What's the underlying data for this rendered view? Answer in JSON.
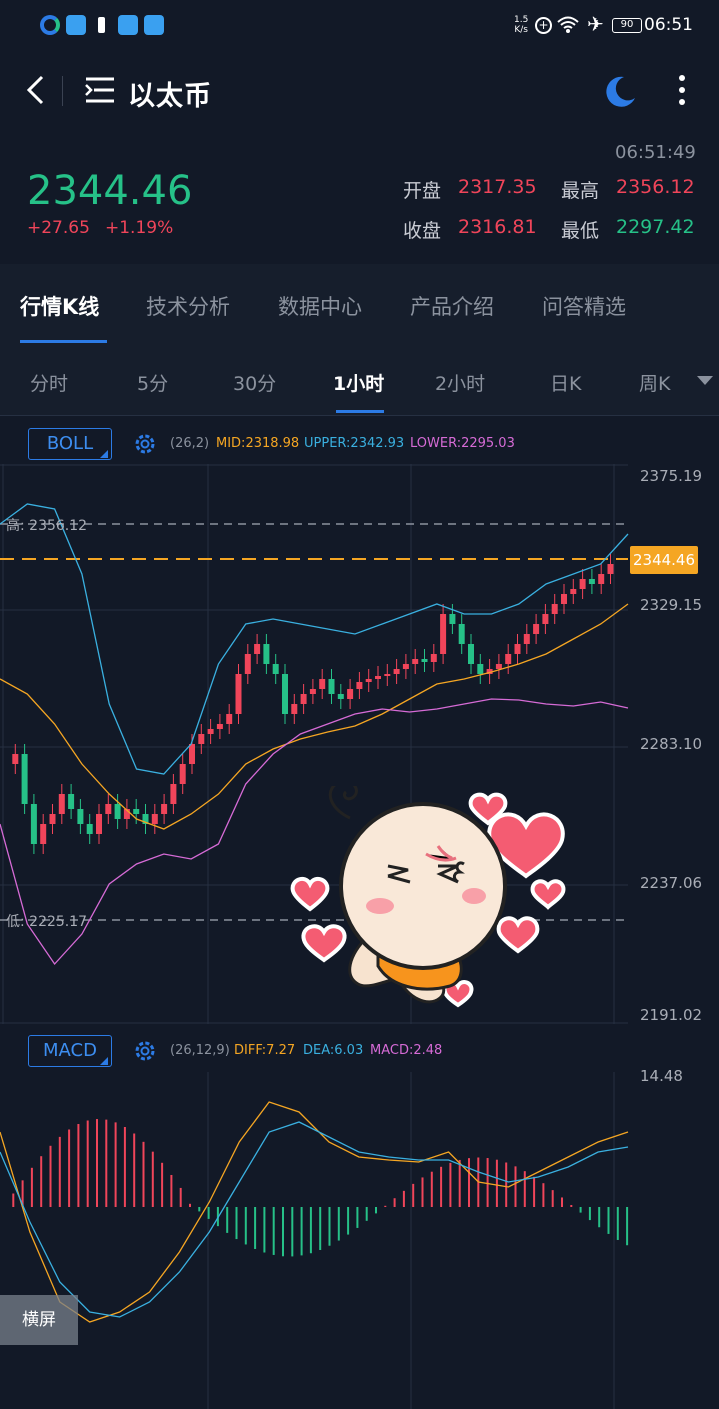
{
  "status": {
    "net_speed_top": "1.5",
    "net_speed_bottom": "K/s",
    "battery": "90",
    "time": "06:51"
  },
  "header": {
    "title": "以太币"
  },
  "quote": {
    "time": "06:51:49",
    "price": "2344.46",
    "change": "+27.65",
    "change_pct": "+1.19%",
    "open_label": "开盘",
    "open": "2317.35",
    "high_label": "最高",
    "high": "2356.12",
    "close_label": "收盘",
    "close": "2316.81",
    "low_label": "最低",
    "low": "2297.42"
  },
  "tabs": [
    {
      "label": "行情K线"
    },
    {
      "label": "技术分析"
    },
    {
      "label": "数据中心"
    },
    {
      "label": "产品介绍"
    },
    {
      "label": "问答精选"
    }
  ],
  "periods": [
    {
      "label": "分时"
    },
    {
      "label": "5分"
    },
    {
      "label": "30分"
    },
    {
      "label": "1小时"
    },
    {
      "label": "2小时"
    },
    {
      "label": "日K"
    },
    {
      "label": "周K"
    }
  ],
  "boll": {
    "name": "BOLL",
    "params": "(26,2)",
    "mid": "MID:2318.98",
    "upper": "UPPER:2342.93",
    "lower": "LOWER:2295.03"
  },
  "kchart": {
    "y_ticks": [
      "2375.19",
      "2329.15",
      "2283.10",
      "2237.06",
      "2191.02"
    ],
    "high_marker": "高: 2356.12",
    "low_marker": "低: 2225.17",
    "last_price": "2344.46"
  },
  "macd": {
    "name": "MACD",
    "params": "(26,12,9)",
    "diff": "DIFF:7.27",
    "dea": "DEA:6.03",
    "macd": "MACD:2.48",
    "y_top": "14.48"
  },
  "landscape_button": "横屏",
  "colors": {
    "up": "#f0455a",
    "down": "#26c188",
    "accent": "#2c7be5",
    "mid": "#f5a623",
    "upper": "#3ab0e0",
    "lower": "#d66bd6"
  },
  "icons": [
    "back-arrow-icon",
    "menu-icon",
    "night-mode-icon",
    "more-icon",
    "settings-icon"
  ]
}
